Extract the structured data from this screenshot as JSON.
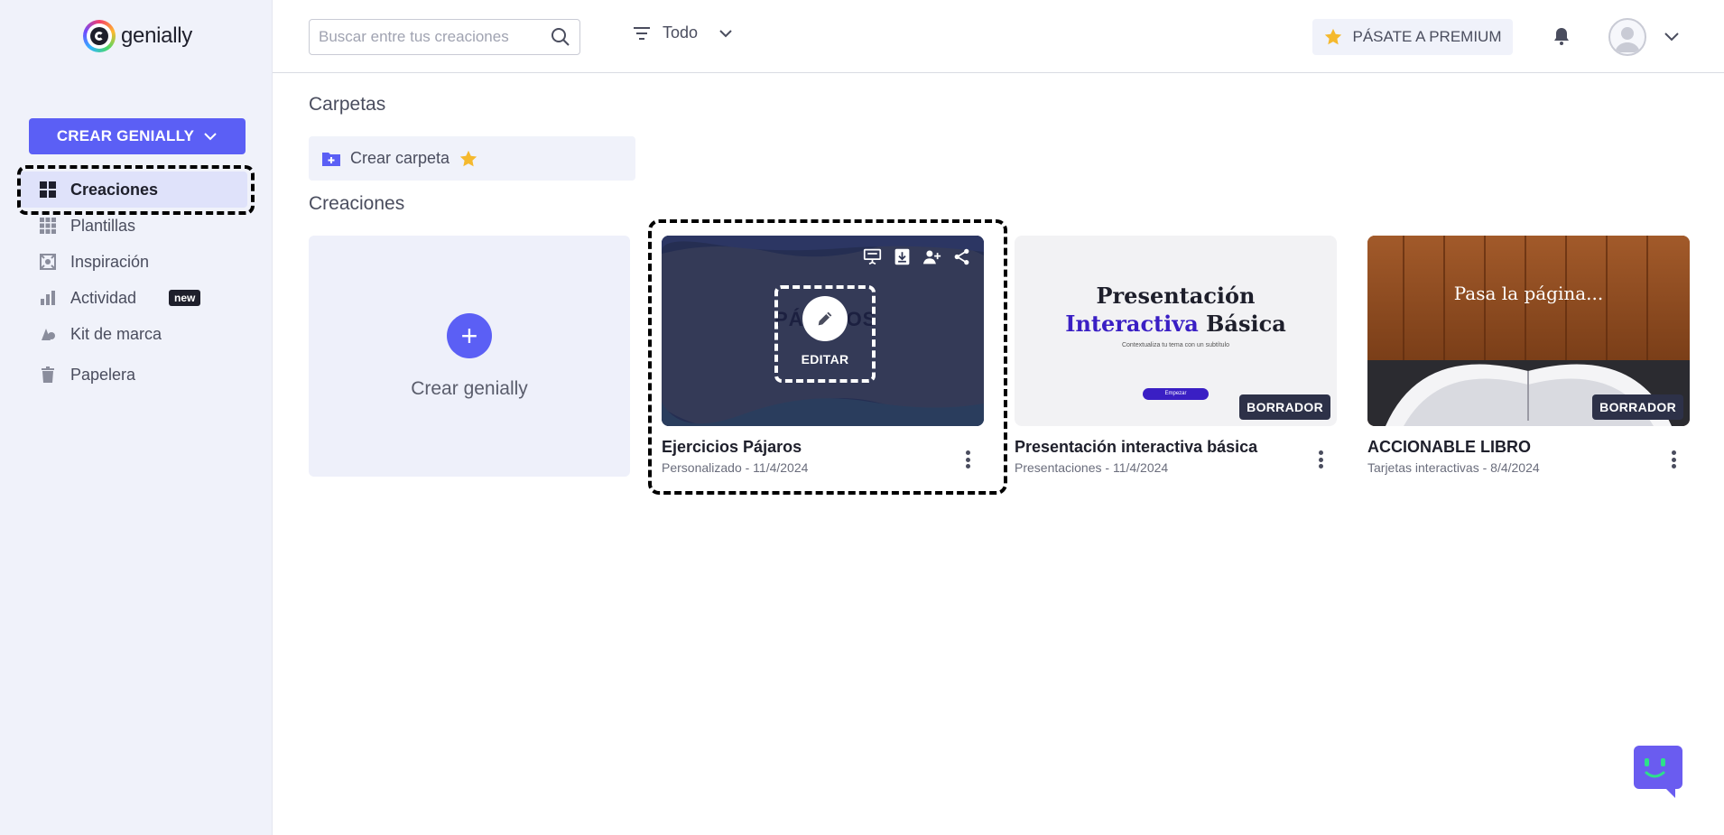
{
  "brand": {
    "name": "genially"
  },
  "sidebar": {
    "create_button": "CREAR GENIALLY",
    "items": [
      {
        "label": "Creaciones",
        "icon": "grid-icon",
        "active": true
      },
      {
        "label": "Plantillas",
        "icon": "templates-icon"
      },
      {
        "label": "Inspiración",
        "icon": "inspiration-icon"
      },
      {
        "label": "Actividad",
        "icon": "bar-chart-icon",
        "badge": "new"
      },
      {
        "label": "Kit de marca",
        "icon": "brand-kit-icon"
      },
      {
        "label": "Papelera",
        "icon": "trash-icon"
      }
    ]
  },
  "header": {
    "search_placeholder": "Buscar entre tus creaciones",
    "filter_label": "Todo",
    "premium_label": "PÁSATE A PREMIUM"
  },
  "main": {
    "folders_title": "Carpetas",
    "create_folder": "Crear carpeta",
    "creations_title": "Creaciones",
    "create_card_label": "Crear genially",
    "edit_label": "EDITAR",
    "cards": [
      {
        "title": "Ejercicios Pájaros",
        "meta": "Personalizado - 11/4/2024",
        "thumb_text": "PÁJAROS"
      },
      {
        "title": "Presentación interactiva básica",
        "meta": "Presentaciones - 11/4/2024",
        "badge": "BORRADOR",
        "thumb_line1": "Presentación",
        "thumb_line2a": "Interactiva",
        "thumb_line2b": "Básica",
        "thumb_sub": "Contextualiza tu tema con un subtítulo",
        "thumb_btn": "Empezar"
      },
      {
        "title": "ACCIONABLE LIBRO",
        "meta": "Tarjetas interactivas - 8/4/2024",
        "badge": "BORRADOR",
        "thumb_text": "Pasa la página..."
      }
    ]
  },
  "colors": {
    "accent": "#5b5ff5",
    "sidebar_bg": "#f0f2fa",
    "dark": "#1e1f2b",
    "draft_bg": "#2d3148",
    "premium_star": "#f5b92e"
  }
}
